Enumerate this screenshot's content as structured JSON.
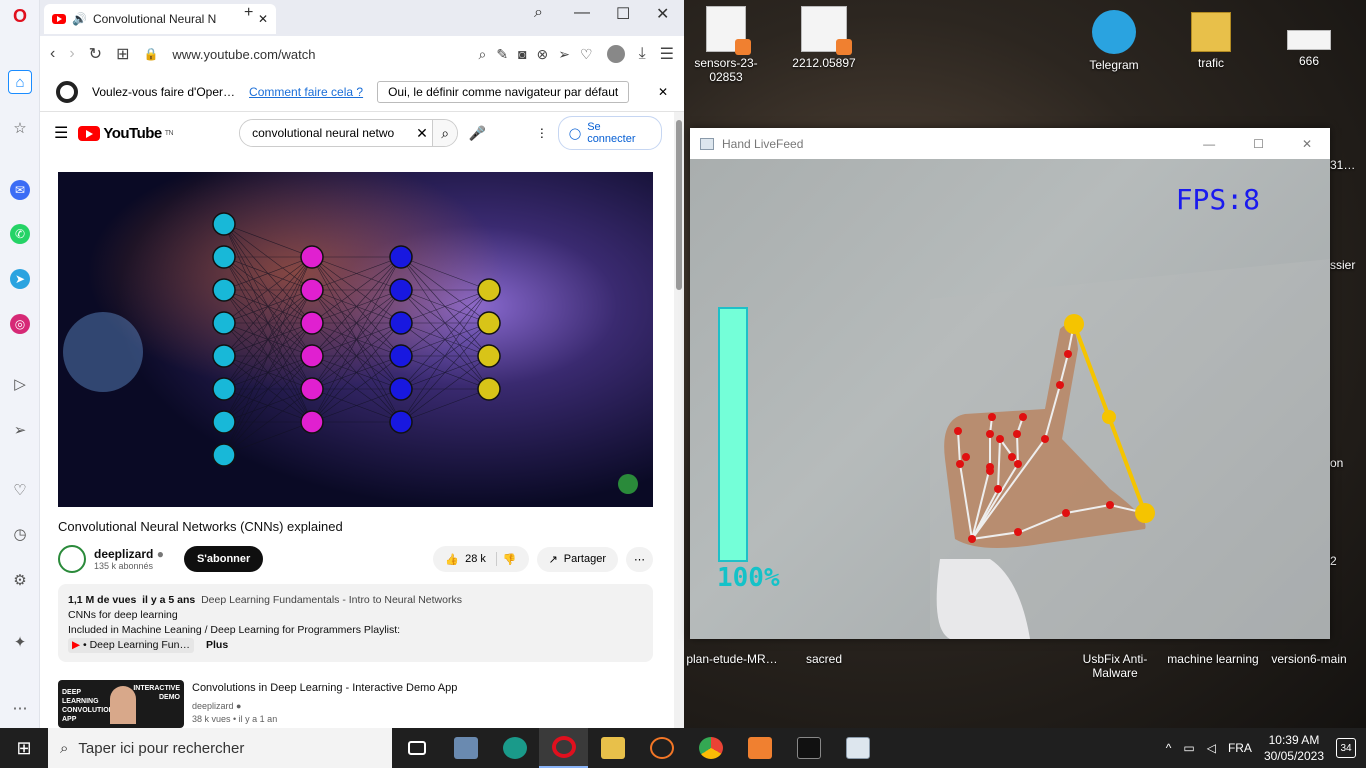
{
  "browser": {
    "tab_title": "Convolutional Neural N",
    "url": "www.youtube.com/watch",
    "infobar": {
      "prompt": "Voulez-vous faire d'Oper…",
      "link": "Comment faire cela ?",
      "button": "Oui, le définir comme navigateur par défaut"
    }
  },
  "youtube": {
    "logo_text": "YouTube",
    "logo_region": "TN",
    "search_value": "convolutional neural netwo",
    "signin_label": "Se connecter",
    "video": {
      "title": "Convolutional Neural Networks (CNNs) explained",
      "channel": "deeplizard",
      "subscribers": "135 k abonnés",
      "subscribe_label": "S'abonner",
      "likes": "28 k",
      "share_label": "Partager"
    },
    "description": {
      "views": "1,1 M de vues",
      "age": "il y a 5 ans",
      "series": "Deep Learning Fundamentals - Intro to Neural Networks",
      "line2": "CNNs for deep learning",
      "line3": "Included in Machine Leaning / Deep Learning for Programmers Playlist:",
      "playlist": "• Deep Learning Fun…",
      "more": "Plus"
    },
    "recommendation": {
      "thumb_text_left": "DEEP LEARNING CONVOLUTION APP",
      "thumb_text_right": "INTERACTIVE DEMO",
      "title": "Convolutions in Deep Learning - Interactive Demo App",
      "channel": "deeplizard",
      "meta": "38 k vues  • il y a 1 an"
    }
  },
  "livefeed": {
    "window_title": "Hand LiveFeed",
    "fps_text": "FPS:8",
    "volume_text": "100%",
    "volume_level": 1.0
  },
  "desktop": {
    "icons": [
      "sensors-23-02853",
      "2212.05897",
      "Telegram",
      "trafic",
      "666",
      "plan-etude-MR…",
      "sacred",
      "UsbFix Anti-Malware",
      "machine learning",
      "version6-main"
    ],
    "partial_right": [
      "31…",
      "ssier",
      "on",
      "2"
    ]
  },
  "taskbar": {
    "search_placeholder": "Taper ici pour rechercher",
    "language": "FRA",
    "time": "10:39 AM",
    "date": "30/05/2023",
    "notifications": "34"
  }
}
